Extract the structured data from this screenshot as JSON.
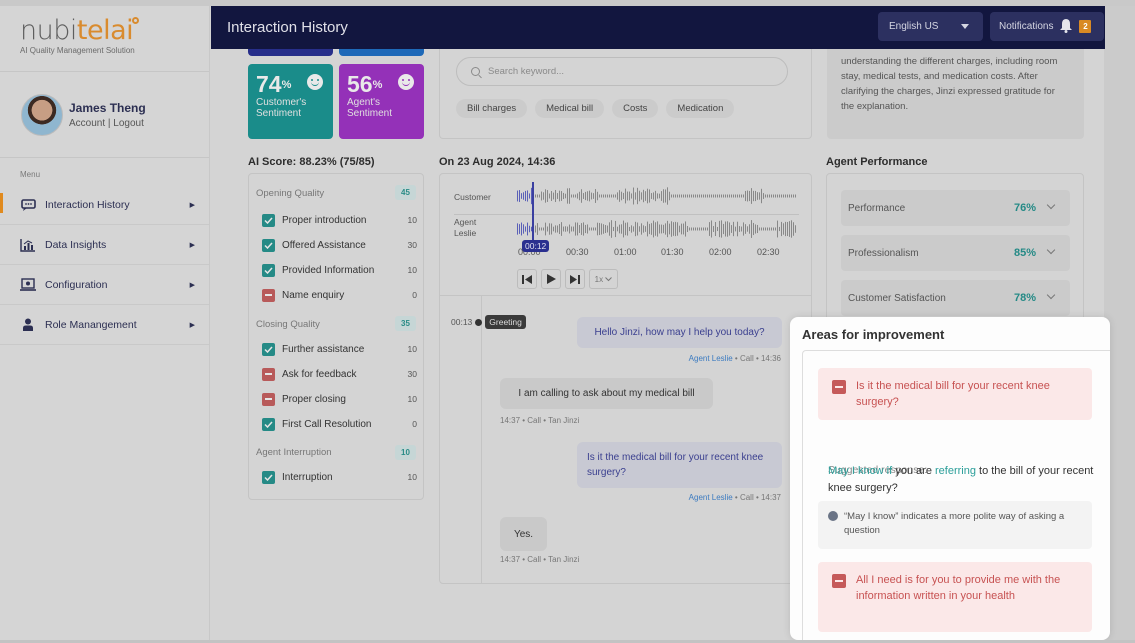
{
  "app": {
    "logo_main": "nubi",
    "logo_accent": "telai",
    "logo_subtitle": "AI Quality Management Solution"
  },
  "user": {
    "name": "James Theng",
    "links": "Account | Logout"
  },
  "sidebar": {
    "menu_label": "Menu",
    "items": [
      {
        "label": "Interaction History",
        "icon": "chat-icon",
        "active": true
      },
      {
        "label": "Data Insights",
        "icon": "chart-icon",
        "active": false
      },
      {
        "label": "Configuration",
        "icon": "laptop-settings-icon",
        "active": false
      },
      {
        "label": "Role Manangement",
        "icon": "person-icon",
        "active": false
      }
    ]
  },
  "header": {
    "title": "Interaction History",
    "language": "English US",
    "notifications_label": "Notifications",
    "notifications_count": "2"
  },
  "sentiment": {
    "customer": {
      "value": "74",
      "unit": "%",
      "label_line1": "Customer's",
      "label_line2": "Sentiment",
      "color": "#1a8c8a"
    },
    "agent": {
      "value": "56",
      "unit": "%",
      "label_line1": "Agent's",
      "label_line2": "Sentiment",
      "color": "#9431b8"
    }
  },
  "search": {
    "placeholder": "Search keyword...",
    "chips": [
      "Bill charges",
      "Medical bill",
      "Costs",
      "Medication"
    ]
  },
  "summary": {
    "text": "understanding the different charges, including room stay, medical tests, and medication costs. After clarifying the charges, Jinzi expressed gratitude for the explanation."
  },
  "ai_score": {
    "title": "AI Score: 88.23% (75/85)",
    "categories": [
      {
        "name": "Opening Quality",
        "score": "45",
        "items": [
          {
            "label": "Proper introduction",
            "value": "10",
            "passed": true
          },
          {
            "label": "Offered Assistance",
            "value": "30",
            "passed": true
          },
          {
            "label": "Provided Information",
            "value": "10",
            "passed": true
          },
          {
            "label": "Name enquiry",
            "value": "0",
            "passed": false
          }
        ]
      },
      {
        "name": "Closing Quality",
        "score": "35",
        "items": [
          {
            "label": "Further assistance",
            "value": "10",
            "passed": true
          },
          {
            "label": "Ask for feedback",
            "value": "30",
            "passed": false
          },
          {
            "label": "Proper closing",
            "value": "10",
            "passed": false
          },
          {
            "label": "First Call Resolution",
            "value": "0",
            "passed": true
          }
        ]
      },
      {
        "name": "Agent Interruption",
        "score": "10",
        "items": [
          {
            "label": "Interruption",
            "value": "10",
            "passed": true
          }
        ]
      }
    ]
  },
  "call": {
    "title": "On 23 Aug 2024, 14:36",
    "tracks": [
      {
        "label_line1": "Customer",
        "label_line2": ""
      },
      {
        "label_line1": "Agent",
        "label_line2": "Leslie"
      }
    ],
    "current_time": "00:12",
    "ticks": [
      "00:00",
      "00:30",
      "01:00",
      "01:30",
      "02:00",
      "02:30"
    ],
    "speed": "1x",
    "marker": {
      "time": "00:13",
      "tag": "Greeting"
    },
    "messages": [
      {
        "side": "agent",
        "text": "Hello Jinzi, how may I help you today?",
        "who": "Agent Leslie",
        "channel": "Call",
        "time": "14:36"
      },
      {
        "side": "customer",
        "text": "I am calling to ask about my medical bill",
        "who": "Tan Jinzi",
        "channel": "Call",
        "time": "14:37"
      },
      {
        "side": "agent",
        "text": "Is it the medical bill for your recent knee surgery?",
        "who": "Agent Leslie",
        "channel": "Call",
        "time": "14:37"
      },
      {
        "side": "customer",
        "text": "Yes.",
        "who": "Tan Jinzi",
        "channel": "Call",
        "time": "14:37"
      }
    ]
  },
  "agent_performance": {
    "title": "Agent Performance",
    "rows": [
      {
        "label": "Performance",
        "value": "76%"
      },
      {
        "label": "Professionalism",
        "value": "85%"
      },
      {
        "label": "Customer Satisfaction",
        "value": "78%"
      }
    ]
  },
  "improvement": {
    "title": "Areas for improvement",
    "issue1": "Is it the medical bill for your recent knee surgery?",
    "suggested_label": "Suggested response:",
    "suggestion_parts": {
      "p1": "May I know if",
      "p2": " you are ",
      "p3": "referring",
      "p4": " to the bill of your recent knee surgery?"
    },
    "note": "“May I know” indicates a more polite way of asking a question",
    "issue2": "All I need is for you to provide me with the information written in your health"
  }
}
